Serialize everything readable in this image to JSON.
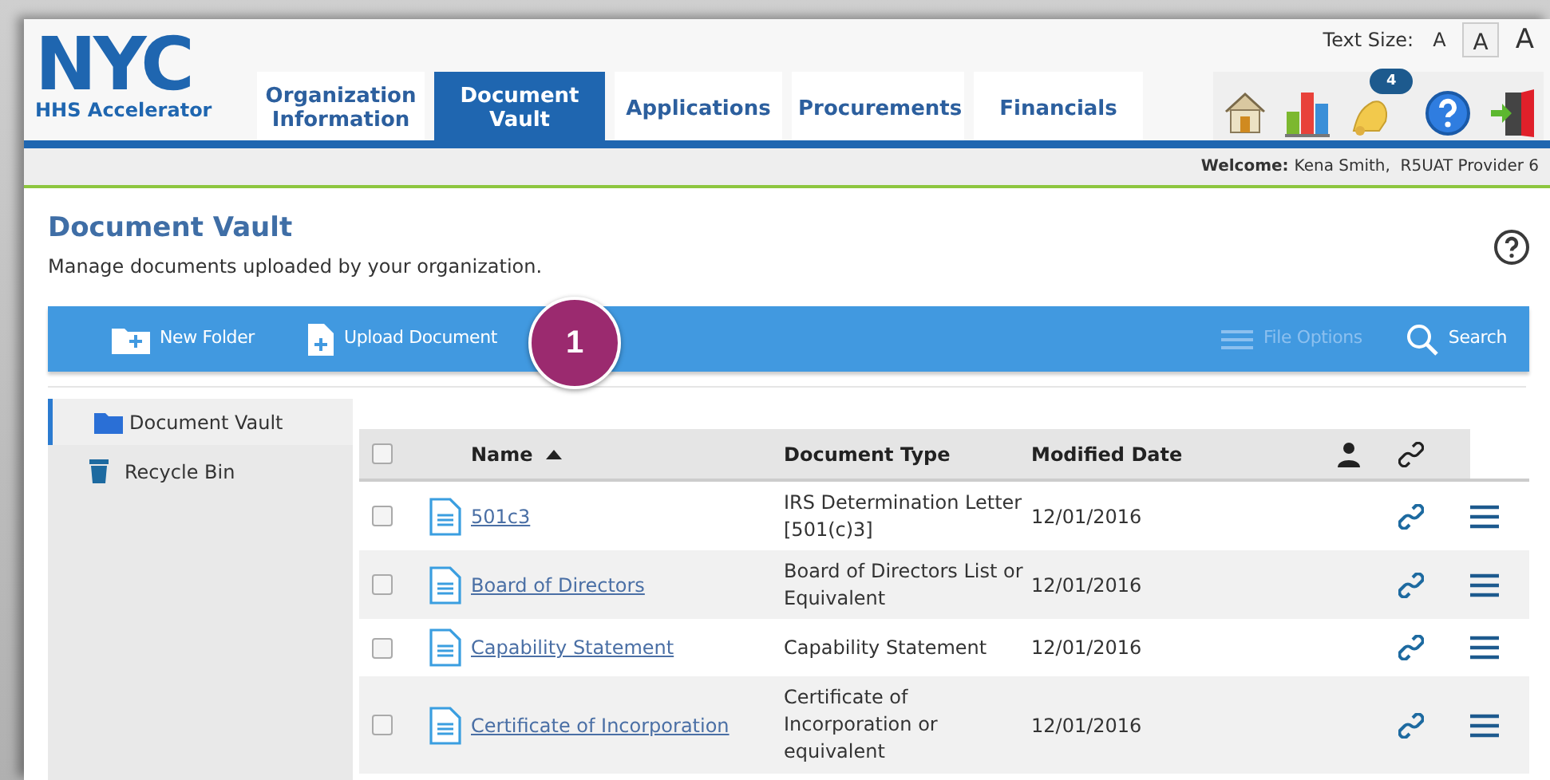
{
  "header": {
    "logo": "NYC",
    "logo_subtitle": "HHS Accelerator",
    "text_size_label": "Text Size:",
    "text_sizes": [
      {
        "label": "A",
        "kind": "small",
        "selected": false
      },
      {
        "label": "A",
        "kind": "medium",
        "selected": true
      },
      {
        "label": "A",
        "kind": "large",
        "selected": false
      }
    ],
    "notification_count": "4"
  },
  "tabs": [
    {
      "label": "Organization Information",
      "selected": false
    },
    {
      "label": "Document Vault",
      "selected": true
    },
    {
      "label": "Applications",
      "selected": false
    },
    {
      "label": "Procurements",
      "selected": false
    },
    {
      "label": "Financials",
      "selected": false
    }
  ],
  "welcome": {
    "label": "Welcome:",
    "user": "Kena Smith,  R5UAT Provider 6"
  },
  "page": {
    "title": "Document Vault",
    "subtitle": "Manage documents uploaded by your organization."
  },
  "toolbar": [
    {
      "label": "New Folder",
      "kind": "folder",
      "disabled": false
    },
    {
      "label": "Upload Document",
      "kind": "upload",
      "disabled": false
    },
    {
      "label": "File Options",
      "kind": "options",
      "disabled": true
    },
    {
      "label": "Search",
      "kind": "search",
      "disabled": false
    }
  ],
  "callout": "1",
  "sidebar": {
    "items": [
      {
        "label": "Document Vault",
        "kind": "folder",
        "selected": true
      },
      {
        "label": "Recycle Bin",
        "kind": "bin",
        "selected": false
      }
    ]
  },
  "table": {
    "select_all_checked": false,
    "columns": [
      {
        "label": "Name",
        "sorted": true
      },
      {
        "label": "Document Type",
        "sorted": false
      },
      {
        "label": "Modified Date",
        "sorted": false
      }
    ],
    "rows": [
      {
        "checked": false,
        "name": "501c3",
        "document_type": "IRS Determination Letter [501(c)3]",
        "modified_date": "12/01/2016"
      },
      {
        "checked": false,
        "name": "Board of Directors",
        "document_type": "Board of Directors List or Equivalent",
        "modified_date": "12/01/2016"
      },
      {
        "checked": false,
        "name": "Capability Statement",
        "document_type": "Capability Statement",
        "modified_date": "12/01/2016"
      },
      {
        "checked": false,
        "name": "Certificate of Incorporation",
        "document_type": "Certificate of Incorporation or equivalent",
        "modified_date": "12/01/2016"
      }
    ]
  }
}
